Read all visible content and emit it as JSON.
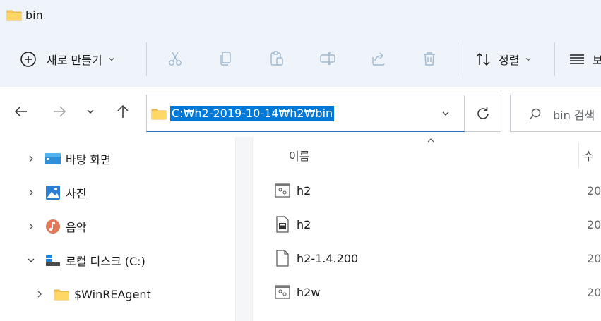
{
  "window": {
    "title": "bin"
  },
  "toolbar": {
    "new_label": "새로 만들기",
    "sort_label": "정렬",
    "view_label": "보"
  },
  "address": {
    "path": "C:₩h2-2019-10-14₩h2₩bin"
  },
  "search": {
    "placeholder": "bin 검색"
  },
  "sidebar": {
    "items": [
      {
        "label": "바탕 화면",
        "icon": "desktop-icon",
        "expanded": false
      },
      {
        "label": "사진",
        "icon": "pictures-icon",
        "expanded": false
      },
      {
        "label": "음악",
        "icon": "music-icon",
        "expanded": false
      },
      {
        "label": "로컬 디스크 (C:)",
        "icon": "drive-icon",
        "expanded": true
      },
      {
        "label": "$WinREAgent",
        "icon": "folder-icon",
        "expanded": false
      }
    ]
  },
  "filelist": {
    "columns": {
      "name": "이름",
      "date": "수"
    },
    "rows": [
      {
        "name": "h2",
        "date": "20",
        "icon": "batch-file-icon"
      },
      {
        "name": "h2",
        "date": "20",
        "icon": "executable-file-icon"
      },
      {
        "name": "h2-1.4.200",
        "date": "20",
        "icon": "blank-file-icon"
      },
      {
        "name": "h2w",
        "date": "20",
        "icon": "batch-file-icon"
      }
    ]
  },
  "colors": {
    "accent": "#0078d7",
    "chrome_bg": "#eef4f9",
    "folder": "#f6c44f"
  }
}
